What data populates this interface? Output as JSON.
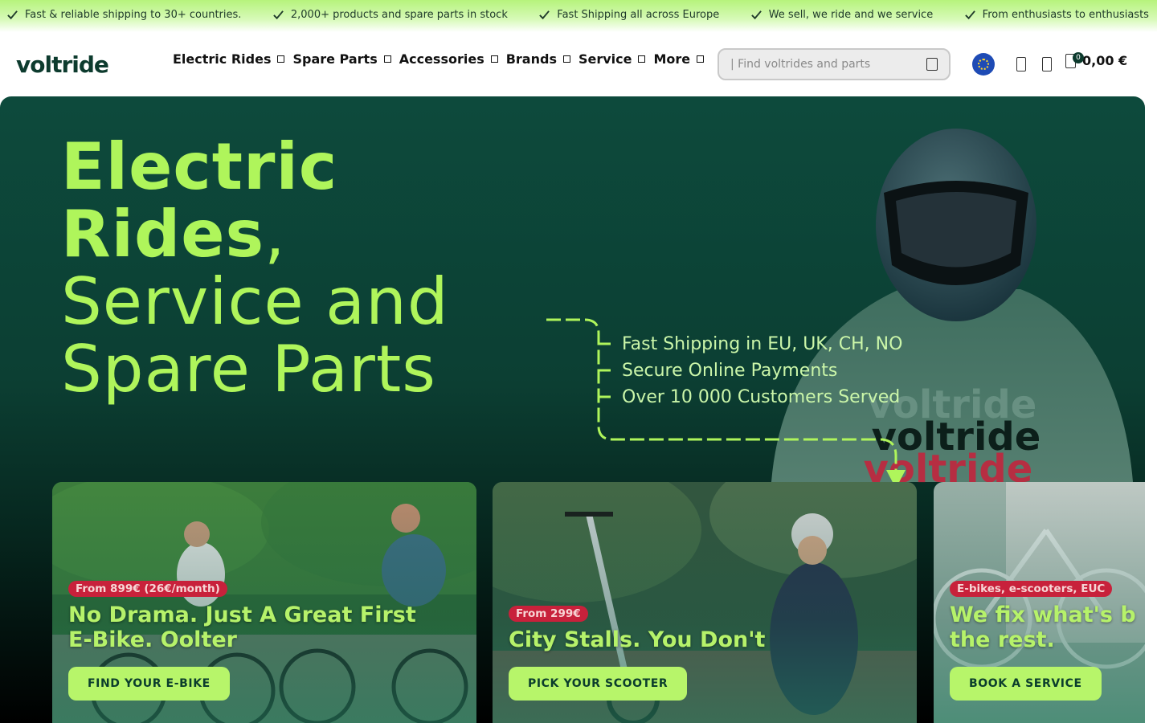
{
  "topbar": {
    "items": [
      "Fast & reliable shipping to 30+ countries.",
      "2,000+ products and spare parts in stock",
      "Fast Shipping all across Europe",
      "We sell, we ride and we service",
      "From enthusiasts to enthusiasts"
    ]
  },
  "header": {
    "logo": "voltride",
    "nav": [
      "Electric Rides",
      "Spare Parts",
      "Accessories",
      "Brands",
      "Service",
      "More"
    ],
    "search_placeholder": "| Find voltrides and parts",
    "cart_count": "0",
    "cart_total": "0,00 €"
  },
  "hero": {
    "title_line1": "Electric",
    "title_line2": "Rides",
    "title_line2_suffix": ",",
    "title_line3": "Service and",
    "title_line4": "Spare Parts",
    "features": [
      "Fast Shipping in EU, UK, CH, NO",
      "Secure Online Payments",
      "Over 10 000 Customers Served"
    ],
    "shirt_text": "voltride"
  },
  "cards": [
    {
      "badge": "From 899€ (26€/month)",
      "title_line1": "No Drama. Just A Great First",
      "title_line2": "E-Bike. Oolter",
      "button": "FIND YOUR E-BIKE"
    },
    {
      "badge": "From 299€",
      "title_line1": "City Stalls. You Don't",
      "title_line2": "",
      "button": "PICK YOUR SCOOTER"
    },
    {
      "badge": "E-bikes, e-scooters, EUC",
      "title_line1": "We fix what's b",
      "title_line2": "the rest.",
      "button": "BOOK A SERVICE"
    }
  ],
  "colors": {
    "accent": "#aff55b",
    "brand_dark": "#0d3b2e",
    "badge_red": "#c8213b"
  }
}
